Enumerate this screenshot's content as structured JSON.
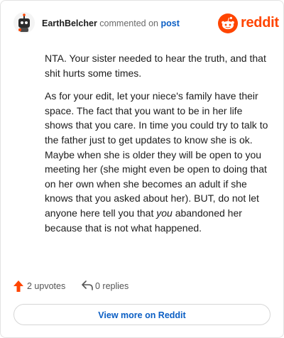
{
  "header": {
    "username": "EarthBelcher",
    "action_text": "commented on",
    "post_link": "post",
    "brand_name": "reddit",
    "brand_color": "#ff4500"
  },
  "comment": {
    "p1": "NTA. Your sister needed to hear the truth, and that shit hurts some times.",
    "p2_before": "As for your edit, let your niece's family have their space. The fact that you want to be in her life shows that you care. In time you could try to talk to the father just to get updates to know she is ok. Maybe when she is older they will be open to you meeting her (she might even be open to doing that on her own when she becomes an adult if she knows that you asked about her). BUT, do not let anyone here tell you that ",
    "p2_emphasis": "you",
    "p2_after": " abandoned her because that is not what happened."
  },
  "actions": {
    "upvotes": "2 upvotes",
    "replies": "0 replies",
    "upvote_icon": "upvote-arrow-icon",
    "reply_icon": "reply-arrow-icon"
  },
  "cta": {
    "label": "View more on Reddit",
    "color": "#0a5ec4"
  }
}
